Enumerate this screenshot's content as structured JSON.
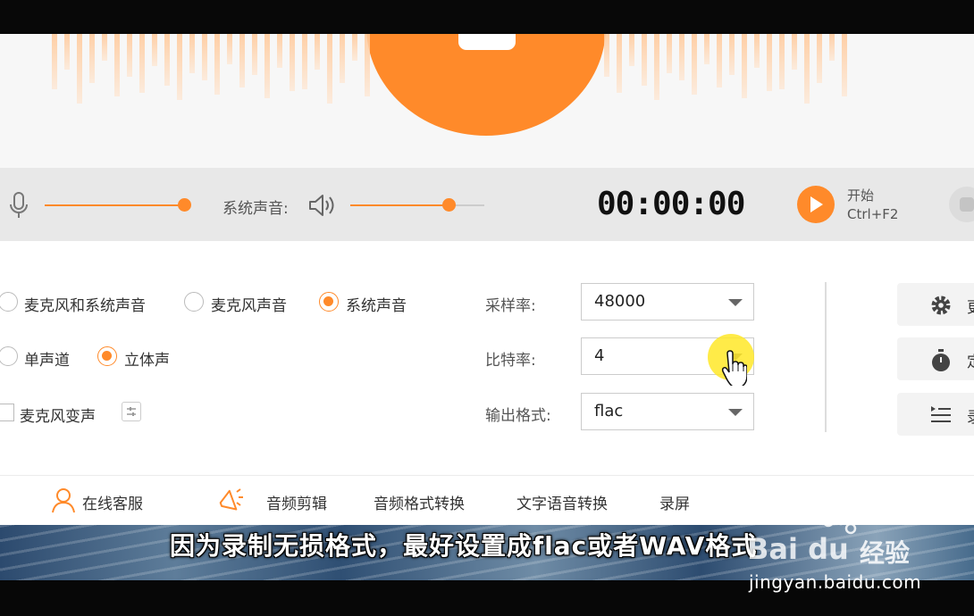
{
  "recorder": {
    "system_sound_label": "系统声音:",
    "timer": "00:00:00",
    "start_label": "开始",
    "start_shortcut": "Ctrl+F2",
    "mic_volume": 0.82,
    "system_volume": 0.73
  },
  "source_options": [
    {
      "label": "麦克风和系统声音",
      "selected": false
    },
    {
      "label": "麦克风声音",
      "selected": false
    },
    {
      "label": "系统声音",
      "selected": true
    }
  ],
  "channel_options": [
    {
      "label": "单声道",
      "selected": false
    },
    {
      "label": "立体声",
      "selected": true
    }
  ],
  "voice_changer": {
    "label": "麦克风变声",
    "checked": false
  },
  "settings": {
    "sample_rate": {
      "label": "采样率:",
      "value": "48000"
    },
    "bit_rate": {
      "label": "比特率:",
      "value": "4"
    },
    "output_format": {
      "label": "输出格式:",
      "value": "flac"
    }
  },
  "side_buttons": [
    {
      "text": "更",
      "icon": "gear-icon"
    },
    {
      "text": "定",
      "icon": "stopwatch-icon"
    },
    {
      "text": "录",
      "icon": "list-icon"
    }
  ],
  "footer_nav": {
    "support": "在线客服",
    "audio_edit": "音频剪辑",
    "format_convert": "音频格式转换",
    "tts": "文字语音转换",
    "screen_record": "录屏"
  },
  "caption": "因为录制无损格式，最好设置成flac或者WAV格式",
  "watermark": {
    "brand": "Bai du",
    "cn": "经验",
    "url": "jingyan.baidu.com"
  },
  "colors": {
    "accent": "#ff8a2a",
    "cursor_highlight": "#ffe828"
  }
}
